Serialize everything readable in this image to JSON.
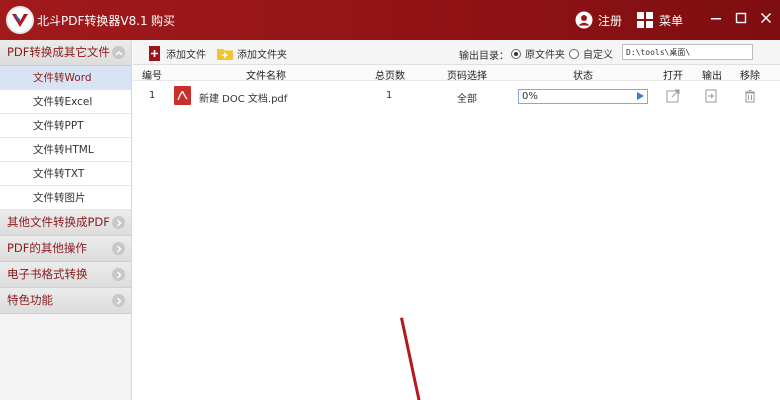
{
  "app": {
    "title": "北斗PDF转换器V8.1",
    "buy": "购买",
    "register": "注册",
    "menu": "菜单"
  },
  "sidebar": {
    "group_main": "PDF转换成其它文件",
    "items": [
      "文件转Word",
      "文件转Excel",
      "文件转PPT",
      "文件转HTML",
      "文件转TXT",
      "文件转图片"
    ],
    "groups": [
      "其他文件转换成PDF",
      "PDF的其他操作",
      "电子书格式转换",
      "特色功能"
    ]
  },
  "toolbar": {
    "add_file": "添加文件",
    "add_folder": "添加文件夹",
    "output_label": "输出目录：",
    "radio_source": "原文件夹",
    "radio_custom": "自定义",
    "output_path": "D:\\tools\\桌面\\"
  },
  "table": {
    "headers": [
      "编号",
      "文件名称",
      "总页数",
      "页码选择",
      "状态",
      "打开",
      "输出",
      "移除"
    ],
    "rows": [
      {
        "index": "1",
        "name": "新建 DOC 文档.pdf",
        "pages": "1",
        "page_select": "全部",
        "progress": "0%",
        "progress_value": 0
      }
    ]
  },
  "colors": {
    "titlebar": "#9a1619",
    "accent": "#8b1a1c",
    "selected": "#d8e4f3"
  }
}
